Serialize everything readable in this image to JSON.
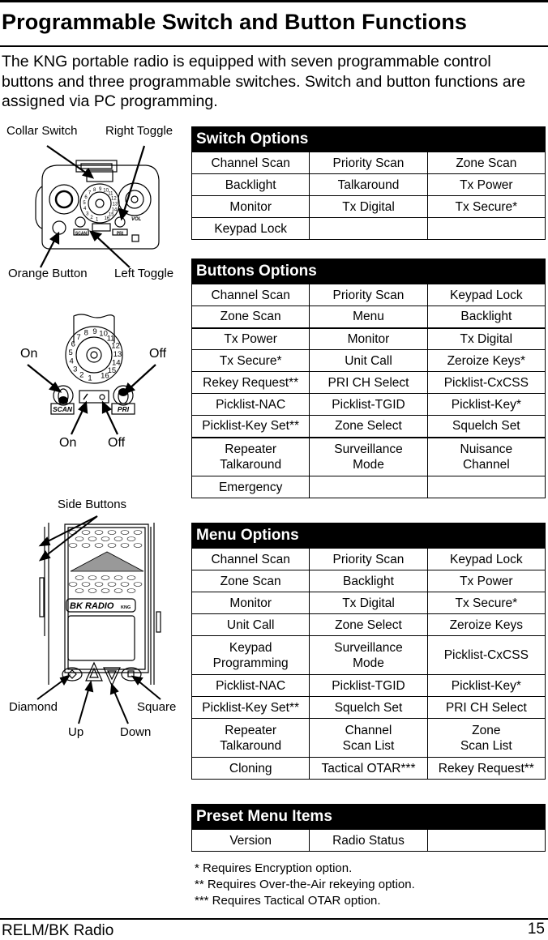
{
  "page": {
    "title": "Programmable Switch and Button Functions",
    "intro": "The KNG portable radio is equipped with seven programmable control buttons and three programmable switches. Switch and button functions are assigned via PC programming.",
    "footer_left": "RELM/BK Radio",
    "page_number": "15"
  },
  "figures": {
    "top_view": {
      "labels": {
        "collar_switch": "Collar Switch",
        "right_toggle": "Right Toggle",
        "orange_button": "Orange Button",
        "left_toggle": "Left Toggle"
      },
      "dial_numbers": [
        "1",
        "2",
        "3",
        "4",
        "5",
        "6",
        "7",
        "8",
        "9",
        "10",
        "11",
        "12",
        "13",
        "14",
        "15",
        "16"
      ],
      "scan_label": "SCAN",
      "pri_label": "PRI",
      "vol_label": "VOL"
    },
    "toggle_detail": {
      "labels": {
        "on_left": "On",
        "off_right": "Off",
        "on_bottom": "On",
        "off_bottom": "Off"
      },
      "dial_numbers": [
        "1",
        "2",
        "3",
        "4",
        "5",
        "6",
        "7",
        "8",
        "9",
        "10",
        "11",
        "12",
        "13",
        "14",
        "15",
        "16"
      ],
      "scan_label": "SCAN",
      "pri_label": "PRI"
    },
    "front_view": {
      "labels": {
        "side_buttons": "Side Buttons",
        "diamond": "Diamond",
        "up": "Up",
        "down": "Down",
        "square": "Square"
      },
      "brand": "BK RADIO",
      "model": "KNG"
    }
  },
  "switch_options": {
    "title": "Switch Options",
    "rows": [
      [
        "Channel Scan",
        "Priority Scan",
        "Zone Scan"
      ],
      [
        "Backlight",
        "Talkaround",
        "Tx Power"
      ],
      [
        "Monitor",
        "Tx Digital",
        "Tx Secure*"
      ],
      [
        "Keypad Lock",
        "",
        ""
      ]
    ]
  },
  "buttons_options": {
    "title": "Buttons Options",
    "rows": [
      [
        "Channel Scan",
        "Priority Scan",
        "Keypad Lock"
      ],
      [
        "Zone Scan",
        "Menu",
        "Backlight"
      ],
      [
        "Tx Power",
        "Monitor",
        "Tx Digital"
      ],
      [
        "Tx Secure*",
        "Unit Call",
        "Zeroize Keys*"
      ],
      [
        "Rekey Request**",
        "PRI CH Select",
        "Picklist-CxCSS"
      ],
      [
        "Picklist-NAC",
        "Picklist-TGID",
        "Picklist-Key*"
      ],
      [
        "Picklist-Key Set**",
        "Zone Select",
        "Squelch Set"
      ],
      [
        "Repeater\nTalkaround",
        "Surveillance\nMode",
        "Nuisance\nChannel"
      ],
      [
        "Emergency",
        "",
        ""
      ]
    ]
  },
  "menu_options": {
    "title": "Menu Options",
    "rows": [
      [
        "Channel Scan",
        "Priority Scan",
        "Keypad Lock"
      ],
      [
        "Zone Scan",
        "Backlight",
        "Tx Power"
      ],
      [
        "Monitor",
        "Tx Digital",
        "Tx Secure*"
      ],
      [
        "Unit Call",
        "Zone Select",
        "Zeroize Keys"
      ],
      [
        "Keypad\nProgramming",
        "Surveillance\nMode",
        "Picklist-CxCSS"
      ],
      [
        "Picklist-NAC",
        "Picklist-TGID",
        "Picklist-Key*"
      ],
      [
        "Picklist-Key Set**",
        "Squelch Set",
        "PRI CH Select"
      ],
      [
        "Repeater\nTalkaround",
        "Channel\nScan List",
        "Zone\nScan List"
      ],
      [
        "Cloning",
        "Tactical OTAR***",
        "Rekey Request**"
      ]
    ]
  },
  "preset_menu_items": {
    "title": "Preset Menu Items",
    "rows": [
      [
        "Version",
        "Radio Status",
        ""
      ]
    ]
  },
  "footnotes": [
    "* Requires Encryption option.",
    "** Requires Over-the-Air rekeying option.",
    "*** Requires Tactical OTAR option."
  ]
}
